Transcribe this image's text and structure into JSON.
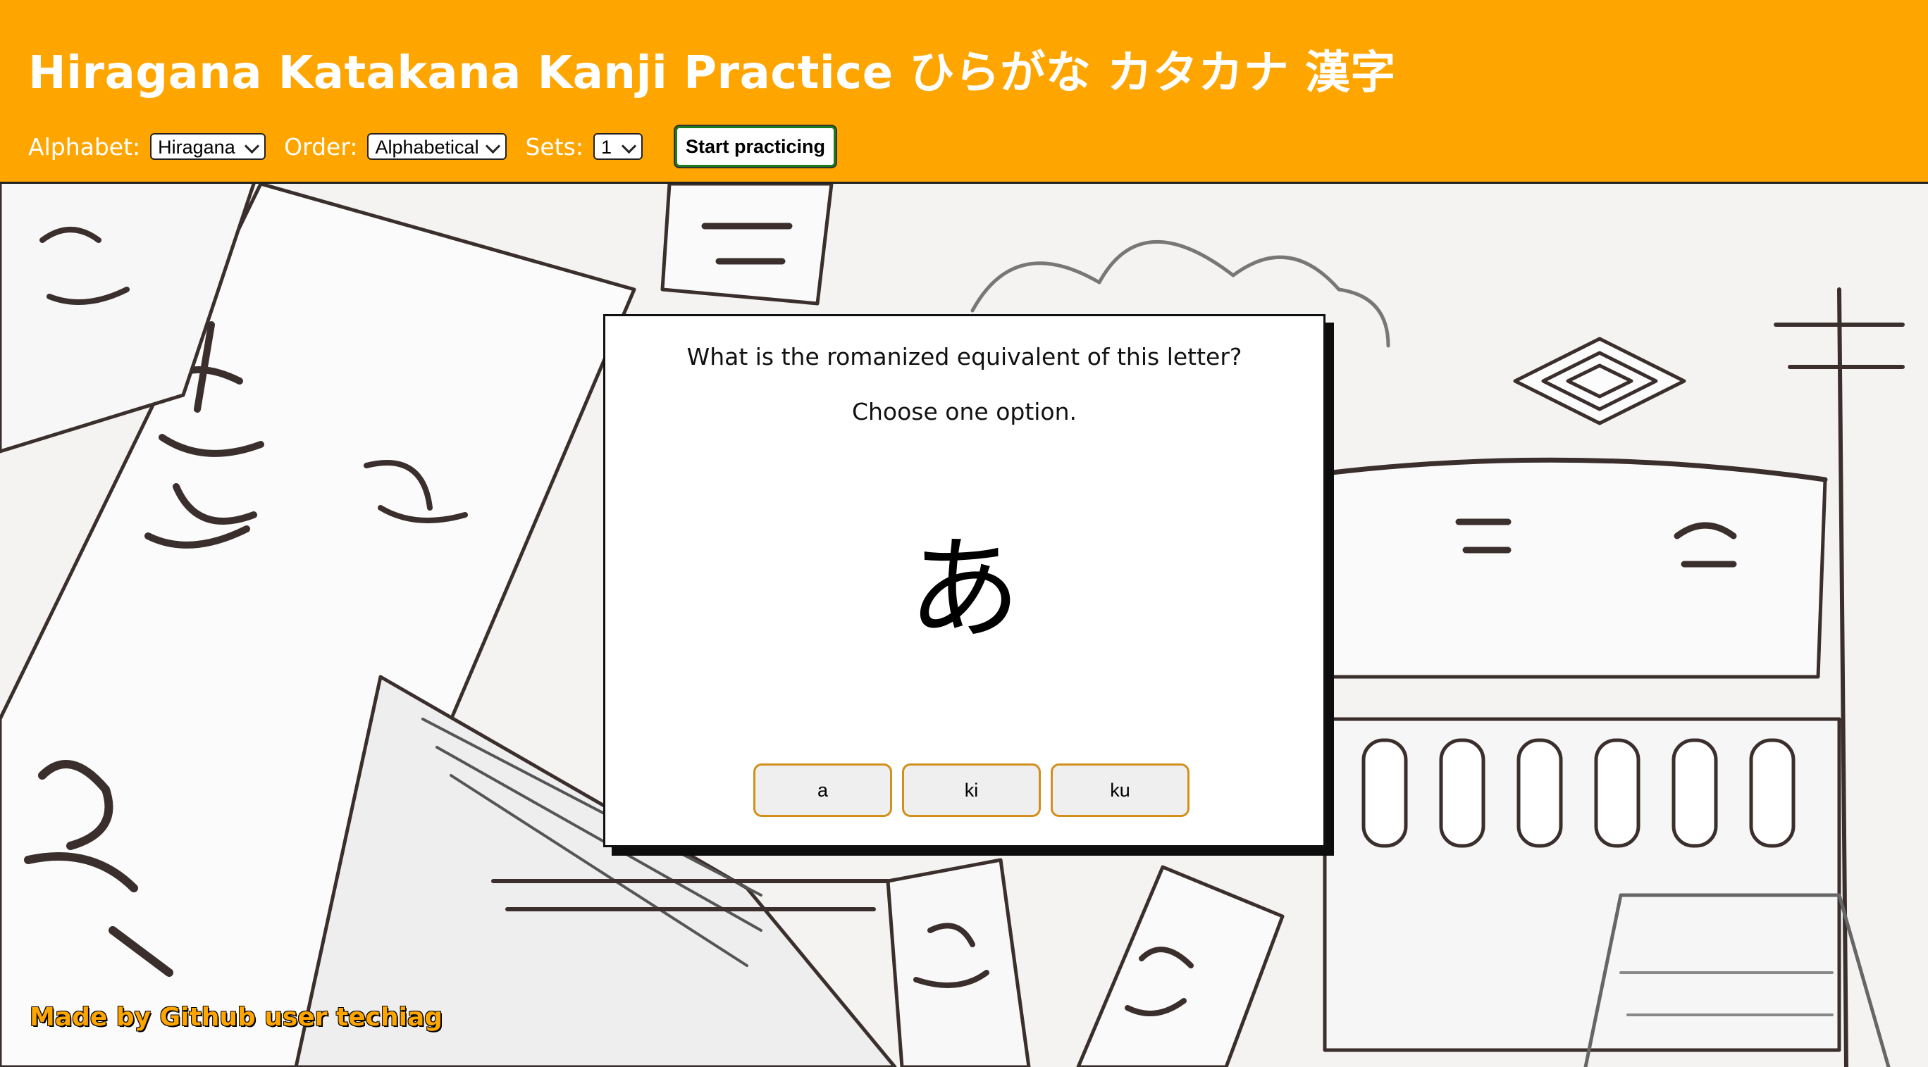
{
  "header": {
    "title": "Hiragana Katakana Kanji Practice ひらがな カタカナ 漢字",
    "alphabet_label": "Alphabet:",
    "alphabet_value": "Hiragana",
    "order_label": "Order:",
    "order_value": "Alphabetical",
    "sets_label": "Sets:",
    "sets_value": "1",
    "start_button": "Start practicing"
  },
  "quiz": {
    "question": "What is the romanized equivalent of this letter?",
    "instruction": "Choose one option.",
    "character": "あ",
    "options": [
      "a",
      "ki",
      "ku"
    ]
  },
  "footer": {
    "credit": "Made by Github user techiag"
  },
  "colors": {
    "header_bg": "#ffa500",
    "option_border": "#d28f1a",
    "start_border": "#1d7a1d"
  }
}
